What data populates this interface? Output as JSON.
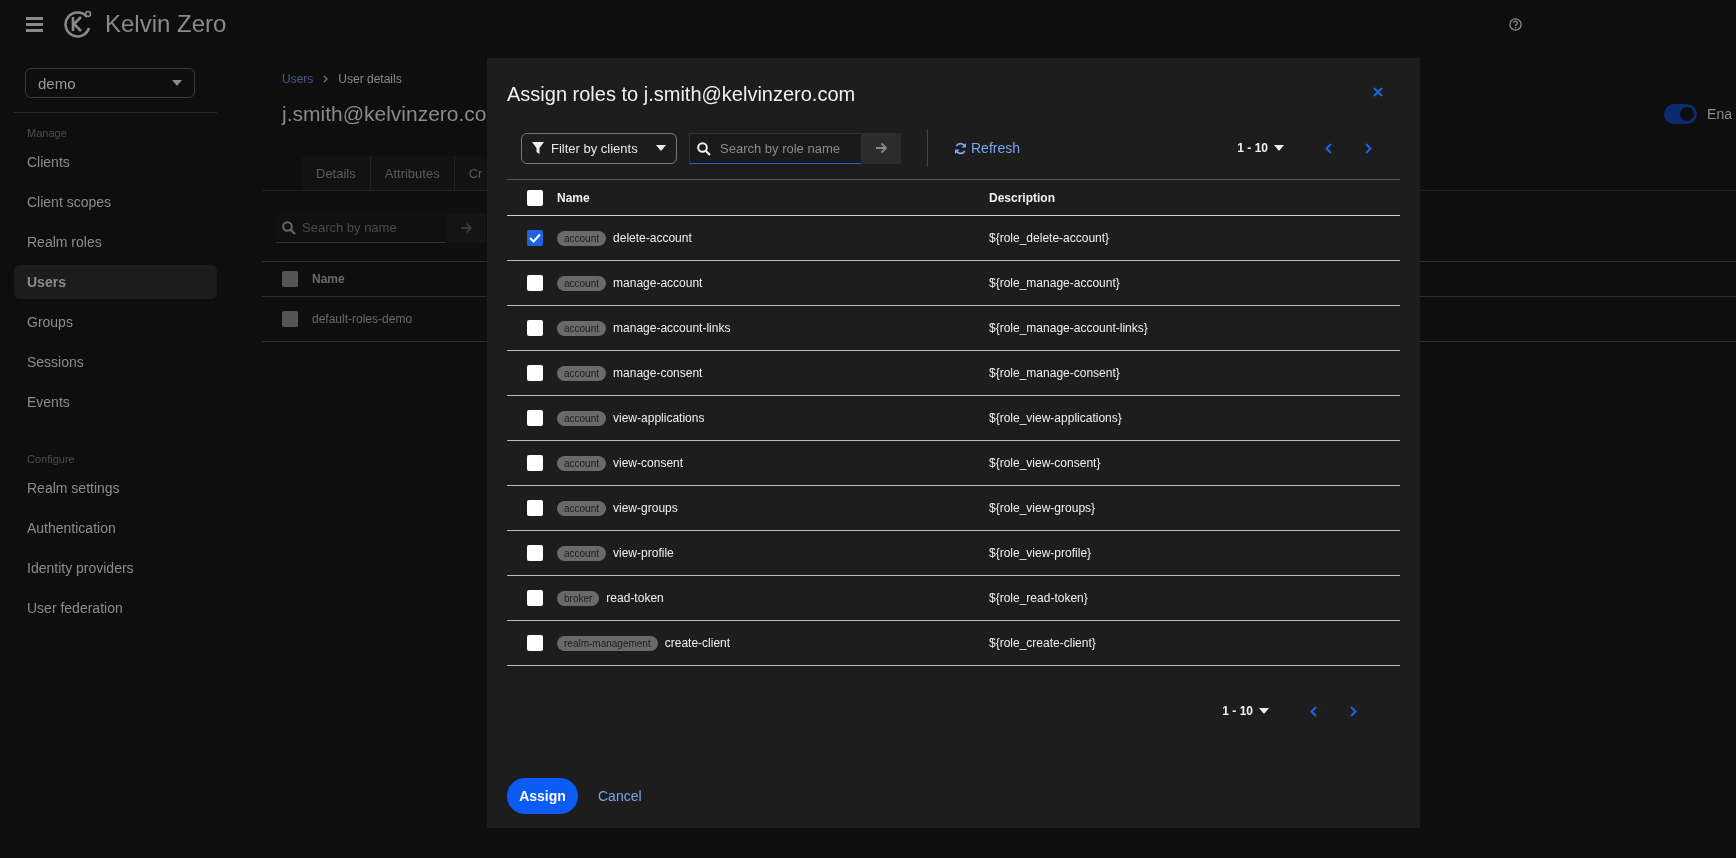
{
  "header": {
    "brand": "Kelvin Zero"
  },
  "sidebar": {
    "realm": "demo",
    "sections": [
      {
        "title": "Manage",
        "items": [
          {
            "label": "Clients",
            "selected": false
          },
          {
            "label": "Client scopes",
            "selected": false
          },
          {
            "label": "Realm roles",
            "selected": false
          },
          {
            "label": "Users",
            "selected": true
          },
          {
            "label": "Groups",
            "selected": false
          },
          {
            "label": "Sessions",
            "selected": false
          },
          {
            "label": "Events",
            "selected": false
          }
        ]
      },
      {
        "title": "Configure",
        "items": [
          {
            "label": "Realm settings",
            "selected": false
          },
          {
            "label": "Authentication",
            "selected": false
          },
          {
            "label": "Identity providers",
            "selected": false
          },
          {
            "label": "User federation",
            "selected": false
          }
        ]
      }
    ]
  },
  "page": {
    "breadcrumb": [
      {
        "label": "Users",
        "kind": "link"
      },
      {
        "label": "User details",
        "kind": "current"
      }
    ],
    "title": "j.smith@kelvinzero.co",
    "enabled": {
      "label": "Ena",
      "on": true
    },
    "tabs": [
      {
        "label": "Details",
        "selected": false
      },
      {
        "label": "Attributes",
        "selected": false
      },
      {
        "label": "Cr",
        "selected": false
      }
    ],
    "search": {
      "placeholder": "Search by name"
    },
    "table": {
      "columns": [
        "Name"
      ],
      "all_checked": false,
      "rows": [
        {
          "name": "default-roles-demo",
          "checked": false
        }
      ]
    }
  },
  "dialog": {
    "title": "Assign roles to j.smith@kelvinzero.com",
    "filter": "Filter by clients",
    "search": {
      "placeholder": "Search by role name"
    },
    "refresh": "Refresh",
    "pagination_top": "1 - 10",
    "columns": [
      "Name",
      "Description"
    ],
    "all_checked": false,
    "rows": [
      {
        "client": "account",
        "name": "delete-account",
        "description": "${role_delete-account}",
        "checked": true
      },
      {
        "client": "account",
        "name": "manage-account",
        "description": "${role_manage-account}",
        "checked": false
      },
      {
        "client": "account",
        "name": "manage-account-links",
        "description": "${role_manage-account-links}",
        "checked": false
      },
      {
        "client": "account",
        "name": "manage-consent",
        "description": "${role_manage-consent}",
        "checked": false
      },
      {
        "client": "account",
        "name": "view-applications",
        "description": "${role_view-applications}",
        "checked": false
      },
      {
        "client": "account",
        "name": "view-consent",
        "description": "${role_view-consent}",
        "checked": false
      },
      {
        "client": "account",
        "name": "view-groups",
        "description": "${role_view-groups}",
        "checked": false
      },
      {
        "client": "account",
        "name": "view-profile",
        "description": "${role_view-profile}",
        "checked": false
      },
      {
        "client": "broker",
        "name": "read-token",
        "description": "${role_read-token}",
        "checked": false
      },
      {
        "client": "realm-management",
        "name": "create-client",
        "description": "${role_create-client}",
        "checked": false
      }
    ],
    "pagination_bottom": "1 - 10",
    "assign": "Assign",
    "cancel": "Cancel"
  }
}
